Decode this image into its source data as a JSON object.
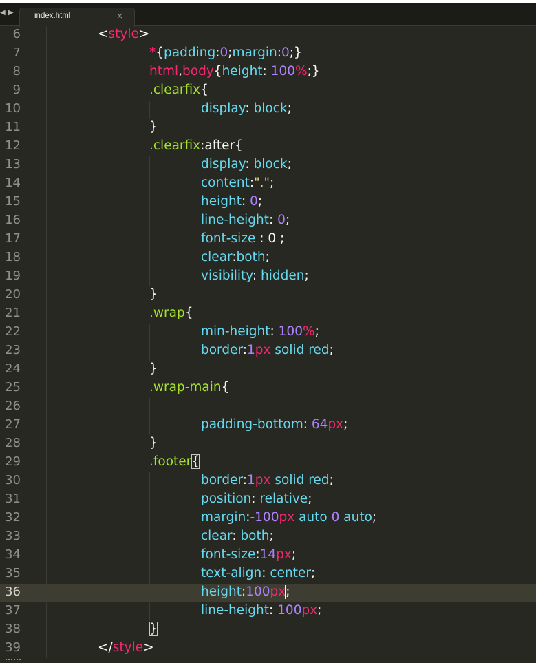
{
  "tabbar": {
    "nav_left_icon": "arrow-left-icon",
    "nav_right_icon": "arrow-right-icon",
    "tab_title": "index.html",
    "tab_close": "×"
  },
  "editor": {
    "theme": {
      "background": "#272822",
      "active_line": "#3e3d32",
      "pink": "#f92672",
      "blue": "#66d9ef",
      "purple": "#ae81ff",
      "green": "#a6e22e",
      "yellow": "#e6db74"
    },
    "active_line_number": "36",
    "lines": [
      {
        "num": "6",
        "indent": 2,
        "tokens": [
          [
            "white",
            "<"
          ],
          [
            "pink",
            "style"
          ],
          [
            "white",
            ">"
          ]
        ]
      },
      {
        "num": "7",
        "indent": 3,
        "tokens": [
          [
            "pink",
            "*"
          ],
          [
            "white",
            "{"
          ],
          [
            "blue",
            "padding"
          ],
          [
            "white",
            ":"
          ],
          [
            "purple",
            "0"
          ],
          [
            "white",
            ";"
          ],
          [
            "blue",
            "margin"
          ],
          [
            "white",
            ":"
          ],
          [
            "purple",
            "0"
          ],
          [
            "white",
            ";}"
          ]
        ]
      },
      {
        "num": "8",
        "indent": 3,
        "tokens": [
          [
            "pink",
            "html"
          ],
          [
            "white",
            ","
          ],
          [
            "pink",
            "body"
          ],
          [
            "white",
            "{"
          ],
          [
            "blue",
            "height"
          ],
          [
            "white",
            ": "
          ],
          [
            "purple",
            "100"
          ],
          [
            "pink",
            "%"
          ],
          [
            "white",
            ";}"
          ]
        ]
      },
      {
        "num": "9",
        "indent": 3,
        "tokens": [
          [
            "green",
            ".clearfix"
          ],
          [
            "white",
            "{"
          ]
        ]
      },
      {
        "num": "10",
        "indent": 4,
        "tokens": [
          [
            "blue",
            "display"
          ],
          [
            "white",
            ": "
          ],
          [
            "blue",
            "block"
          ],
          [
            "white",
            ";"
          ]
        ]
      },
      {
        "num": "11",
        "indent": 3,
        "tokens": [
          [
            "white",
            "}"
          ]
        ]
      },
      {
        "num": "12",
        "indent": 3,
        "tokens": [
          [
            "green",
            ".clearfix"
          ],
          [
            "white",
            ":after{"
          ]
        ]
      },
      {
        "num": "13",
        "indent": 4,
        "tokens": [
          [
            "blue",
            "display"
          ],
          [
            "white",
            ": "
          ],
          [
            "blue",
            "block"
          ],
          [
            "white",
            ";"
          ]
        ]
      },
      {
        "num": "14",
        "indent": 4,
        "tokens": [
          [
            "blue",
            "content"
          ],
          [
            "white",
            ":"
          ],
          [
            "yellow",
            "\".\""
          ],
          [
            "white",
            ";"
          ]
        ]
      },
      {
        "num": "15",
        "indent": 4,
        "tokens": [
          [
            "blue",
            "height"
          ],
          [
            "white",
            ": "
          ],
          [
            "purple",
            "0"
          ],
          [
            "white",
            ";"
          ]
        ]
      },
      {
        "num": "16",
        "indent": 4,
        "tokens": [
          [
            "blue",
            "line-height"
          ],
          [
            "white",
            ": "
          ],
          [
            "purple",
            "0"
          ],
          [
            "white",
            ";"
          ]
        ]
      },
      {
        "num": "17",
        "indent": 4,
        "tokens": [
          [
            "blue",
            "font-size"
          ],
          [
            "white",
            " : 0 ;"
          ]
        ]
      },
      {
        "num": "18",
        "indent": 4,
        "tokens": [
          [
            "blue",
            "clear"
          ],
          [
            "white",
            ":"
          ],
          [
            "blue",
            "both"
          ],
          [
            "white",
            ";"
          ]
        ]
      },
      {
        "num": "19",
        "indent": 4,
        "tokens": [
          [
            "blue",
            "visibility"
          ],
          [
            "white",
            ": "
          ],
          [
            "blue",
            "hidden"
          ],
          [
            "white",
            ";"
          ]
        ]
      },
      {
        "num": "20",
        "indent": 3,
        "tokens": [
          [
            "white",
            "}"
          ]
        ]
      },
      {
        "num": "21",
        "indent": 3,
        "tokens": [
          [
            "green",
            ".wrap"
          ],
          [
            "white",
            "{"
          ]
        ]
      },
      {
        "num": "22",
        "indent": 4,
        "tokens": [
          [
            "blue",
            "min-height"
          ],
          [
            "white",
            ": "
          ],
          [
            "purple",
            "100"
          ],
          [
            "pink",
            "%"
          ],
          [
            "white",
            ";"
          ]
        ]
      },
      {
        "num": "23",
        "indent": 4,
        "tokens": [
          [
            "blue",
            "border"
          ],
          [
            "white",
            ":"
          ],
          [
            "purple",
            "1"
          ],
          [
            "pink",
            "px"
          ],
          [
            "white",
            " "
          ],
          [
            "blue",
            "solid"
          ],
          [
            "white",
            " "
          ],
          [
            "blue",
            "red"
          ],
          [
            "white",
            ";"
          ]
        ]
      },
      {
        "num": "24",
        "indent": 3,
        "tokens": [
          [
            "white",
            "}"
          ]
        ]
      },
      {
        "num": "25",
        "indent": 3,
        "tokens": [
          [
            "green",
            ".wrap-main"
          ],
          [
            "white",
            "{"
          ]
        ]
      },
      {
        "num": "26",
        "indent": 4,
        "tokens": []
      },
      {
        "num": "27",
        "indent": 4,
        "tokens": [
          [
            "blue",
            "padding-bottom"
          ],
          [
            "white",
            ": "
          ],
          [
            "purple",
            "64"
          ],
          [
            "pink",
            "px"
          ],
          [
            "white",
            ";"
          ]
        ]
      },
      {
        "num": "28",
        "indent": 3,
        "tokens": [
          [
            "white",
            "}"
          ]
        ]
      },
      {
        "num": "29",
        "indent": 3,
        "tokens": [
          [
            "green",
            ".footer"
          ],
          [
            "match",
            "{"
          ]
        ]
      },
      {
        "num": "30",
        "indent": 4,
        "tokens": [
          [
            "blue",
            "border"
          ],
          [
            "white",
            ":"
          ],
          [
            "purple",
            "1"
          ],
          [
            "pink",
            "px"
          ],
          [
            "white",
            " "
          ],
          [
            "blue",
            "solid"
          ],
          [
            "white",
            " "
          ],
          [
            "blue",
            "red"
          ],
          [
            "white",
            ";"
          ]
        ]
      },
      {
        "num": "31",
        "indent": 4,
        "tokens": [
          [
            "blue",
            "position"
          ],
          [
            "white",
            ": "
          ],
          [
            "blue",
            "relative"
          ],
          [
            "white",
            ";"
          ]
        ]
      },
      {
        "num": "32",
        "indent": 4,
        "tokens": [
          [
            "blue",
            "margin"
          ],
          [
            "white",
            ":"
          ],
          [
            "purple",
            "-100"
          ],
          [
            "pink",
            "px"
          ],
          [
            "white",
            " "
          ],
          [
            "blue",
            "auto"
          ],
          [
            "white",
            " "
          ],
          [
            "purple",
            "0"
          ],
          [
            "white",
            " "
          ],
          [
            "blue",
            "auto"
          ],
          [
            "white",
            ";"
          ]
        ]
      },
      {
        "num": "33",
        "indent": 4,
        "tokens": [
          [
            "blue",
            "clear"
          ],
          [
            "white",
            ": "
          ],
          [
            "blue",
            "both"
          ],
          [
            "white",
            ";"
          ]
        ]
      },
      {
        "num": "34",
        "indent": 4,
        "tokens": [
          [
            "blue",
            "font-size"
          ],
          [
            "white",
            ":"
          ],
          [
            "purple",
            "14"
          ],
          [
            "pink",
            "px"
          ],
          [
            "white",
            ";"
          ]
        ]
      },
      {
        "num": "35",
        "indent": 4,
        "tokens": [
          [
            "blue",
            "text-align"
          ],
          [
            "white",
            ": "
          ],
          [
            "blue",
            "center"
          ],
          [
            "white",
            ";"
          ]
        ]
      },
      {
        "num": "36",
        "indent": 4,
        "tokens": [
          [
            "blue",
            "height"
          ],
          [
            "white",
            ":"
          ],
          [
            "purple",
            "100"
          ],
          [
            "pink",
            "px"
          ],
          [
            "caret",
            ";"
          ]
        ]
      },
      {
        "num": "37",
        "indent": 4,
        "tokens": [
          [
            "blue",
            "line-height"
          ],
          [
            "white",
            ": "
          ],
          [
            "purple",
            "100"
          ],
          [
            "pink",
            "px"
          ],
          [
            "white",
            ";"
          ]
        ]
      },
      {
        "num": "38",
        "indent": 3,
        "tokens": [
          [
            "match",
            "}"
          ]
        ]
      },
      {
        "num": "39",
        "indent": 2,
        "tokens": [
          [
            "white",
            "</"
          ],
          [
            "pink",
            "style"
          ],
          [
            "white",
            ">"
          ]
        ]
      }
    ]
  }
}
